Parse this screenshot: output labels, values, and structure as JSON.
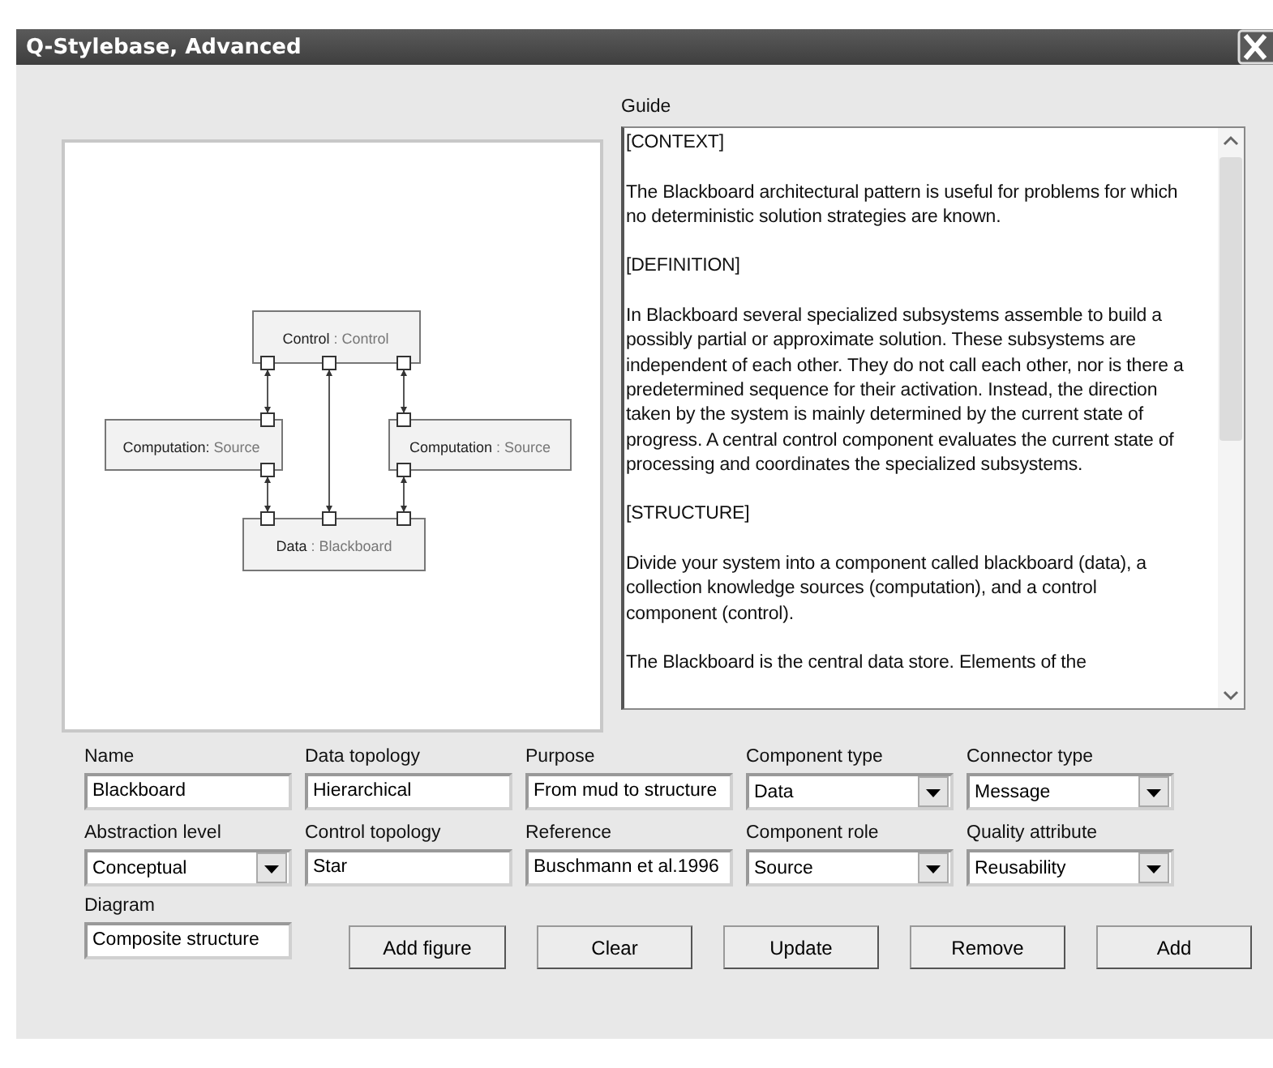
{
  "window": {
    "title": "Q-Stylebase, Advanced"
  },
  "diagram": {
    "nodes": [
      {
        "name": "Control",
        "type": ": Control"
      },
      {
        "name": "Computation:",
        "type": "Source"
      },
      {
        "name": "Computation",
        "type": ": Source"
      },
      {
        "name": "Data",
        "type": ": Blackboard"
      }
    ]
  },
  "guide": {
    "label": "Guide",
    "paragraphs": [
      "[CONTEXT]",
      "The Blackboard architectural pattern is useful for problems for which no deterministic solution strategies are known.",
      "[DEFINITION]",
      "In Blackboard several specialized subsystems assemble to build a possibly partial or approximate solution. These subsystems are independent of each other. They do not call each other, nor is there a predetermined sequence for their activation. Instead, the direction taken by the system is mainly determined by the current state of progress. A central control component evaluates the current state of processing and coordinates the specialized subsystems.",
      "[STRUCTURE]",
      "Divide your system into a component called blackboard (data), a collection knowledge sources (computation), and a control component (control).",
      "The Blackboard is the central data store. Elements of the"
    ]
  },
  "fields": [
    {
      "label": "Name",
      "kind": "text",
      "value": "Blackboard"
    },
    {
      "label": "Data topology",
      "kind": "text",
      "value": "Hierarchical"
    },
    {
      "label": "Purpose",
      "kind": "text",
      "value": "From mud to structure"
    },
    {
      "label": "Component type",
      "kind": "select",
      "value": "Data"
    },
    {
      "label": "Connector type",
      "kind": "select",
      "value": "Message"
    },
    {
      "label": "Abstraction level",
      "kind": "select",
      "value": "Conceptual"
    },
    {
      "label": "Control topology",
      "kind": "text",
      "value": "Star"
    },
    {
      "label": "Reference",
      "kind": "text",
      "value": "Buschmann et al.1996"
    },
    {
      "label": "Component role",
      "kind": "select",
      "value": "Source"
    },
    {
      "label": "Quality attribute",
      "kind": "select",
      "value": "Reusability"
    }
  ],
  "diagram_field": {
    "label": "Diagram",
    "value": "Composite structure"
  },
  "buttons": [
    "Add figure",
    "Clear",
    "Update",
    "Remove",
    "Add"
  ]
}
